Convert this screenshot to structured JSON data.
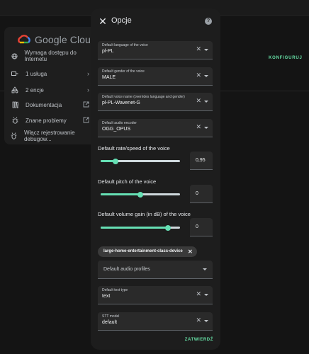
{
  "background": {
    "logo": {
      "icon": "google-cloud-logo",
      "text": "Google Cloud"
    },
    "sidebar": [
      {
        "icon": "globe-icon",
        "label": "Wymaga dostępu do Internetu"
      },
      {
        "icon": "service-icon",
        "label": "1 usługa"
      },
      {
        "icon": "entity-icon",
        "label": "2 encje"
      },
      {
        "icon": "book-icon",
        "label": "Dokumentacja"
      },
      {
        "icon": "bug-icon",
        "label": "Znane problemy"
      },
      {
        "icon": "debug-icon",
        "label": "Włącz rejestrowanie debugow..."
      }
    ],
    "configure_label": "KONFIGURUJ"
  },
  "dialog": {
    "title": "Opcje",
    "close_icon": "close-icon",
    "help_icon": "help-icon",
    "fields": {
      "language": {
        "label": "Default language of the voice",
        "value": "pl-PL"
      },
      "gender": {
        "label": "Default gender of the voice",
        "value": "MALE"
      },
      "voice_name": {
        "label": "Default voice name (overrides language and gender)",
        "value": "pl-PL-Wavenet-G"
      },
      "encoder": {
        "label": "Default audio encoder",
        "value": "OGG_OPUS"
      }
    },
    "sliders": {
      "rate": {
        "label": "Default rate/speed of the voice",
        "display": "0,95",
        "fraction": 0.19
      },
      "pitch": {
        "label": "Default pitch of the voice",
        "display": "0",
        "fraction": 0.5
      },
      "gain": {
        "label": "Default volume gain (in dB) of the voice",
        "display": "0",
        "fraction": 0.85
      }
    },
    "chip": {
      "label": "large-home-entertainment-class-device"
    },
    "profiles_placeholder": "Default audio profiles",
    "text_type": {
      "label": "Default text type",
      "value": "text"
    },
    "stt_model": {
      "label": "STT model",
      "value": "default"
    },
    "confirm_label": "ZATWIERDŹ"
  },
  "colors": {
    "accent": "#66e0b4",
    "dialog_bg": "#1d1d1d",
    "field_bg": "#2a2a2a"
  }
}
